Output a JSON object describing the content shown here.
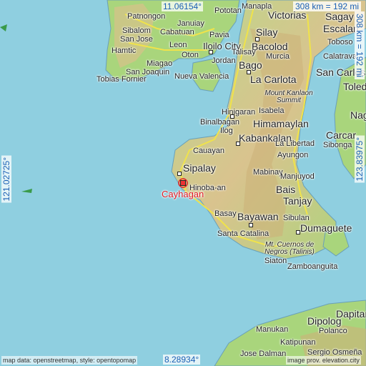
{
  "map": {
    "target": "Cayhagan",
    "coords": {
      "top": "11.06154°",
      "bottom": "8.28934°",
      "left": "121.02725°",
      "right": "123.83975°"
    },
    "scale": {
      "horizontal": "308 km = 192 mi",
      "vertical": "308 km = 192 mi"
    },
    "credit_left": "map data: openstreetmap, style: opentopomap",
    "credit_right": "image prov. elevation.city",
    "colors": {
      "sea": "#8fcfe0",
      "lowland": "#a9d57c",
      "highland": "#d8c08a",
      "road": "#f0e34a",
      "target": "#e01b24"
    },
    "places": [
      "Patnongon",
      "Pototan",
      "Manapla",
      "Victorias",
      "Sagay",
      "Escalan",
      "Sibalom",
      "Januiay",
      "Silay",
      "San Jose",
      "Cabatuan",
      "Pavia",
      "Bacolod",
      "Hamtic",
      "Leon",
      "Iloilo City",
      "Talisay",
      "Murcia",
      "Toboso",
      "Calatrava",
      "Miagao",
      "Oton",
      "Jordan",
      "San Joaquin",
      "Bago",
      "San Carlos",
      "Tobias Fornier",
      "Nueva Valencia",
      "La Carlota",
      "Toledo",
      "Mount Kanlaon Summit",
      "Hinigaran",
      "Isabela",
      "Naga",
      "Binalbagan",
      "Himamaylan",
      "Carcar",
      "Ilog",
      "Kabankalan",
      "Sibonga",
      "Cauayan",
      "La Libertad",
      "Ayungon",
      "Sipalay",
      "Mabinay",
      "Manjuyod",
      "Hinoba-an",
      "Bais",
      "Tanjay",
      "Basay",
      "Bayawan",
      "Sibulan",
      "Dumaguete",
      "Santa Catalina",
      "Mt. Cuernos de Negros (Talinis)",
      "Siaton",
      "Zamboanguita",
      "Dapitan",
      "Dipolog",
      "Manukan",
      "Polanco",
      "Katipunan",
      "Jose Dalman",
      "Sergio Osmeña"
    ]
  }
}
